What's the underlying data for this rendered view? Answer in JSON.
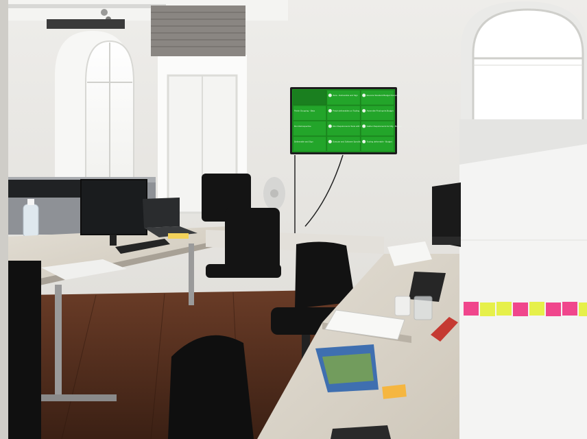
{
  "scene": {
    "description_label": "",
    "wall_color": "#e7e6e3",
    "floor_color": "#5a3322",
    "desk_color": "#dcd7cd"
  },
  "monitor_board": {
    "accent": "#1f9a25",
    "cells": [
      {
        "text": ""
      },
      {
        "text": "Zara - Deliverable and Sign"
      },
      {
        "text": "Execute Standard Budget Document"
      },
      {
        "text": "Finish Grouping - Beta"
      },
      {
        "text": "Fetch deliverables on Tooling"
      },
      {
        "text": "Assemble Final sprint Budget"
      },
      {
        "text": "Run Retrospective"
      },
      {
        "text": "Run Requirements Tests with Tooling"
      },
      {
        "text": "Gather Requirements for Mig - Budget"
      },
      {
        "text": "Deliverable and Sign"
      },
      {
        "text": "Execute and Software Specifications"
      },
      {
        "text": "Tooling deliverable - Budget"
      }
    ]
  },
  "sticky_notes": [
    {
      "color": "#f0468c"
    },
    {
      "color": "#e6f04a"
    },
    {
      "color": "#e6f04a"
    },
    {
      "color": "#f0468c"
    },
    {
      "color": "#e6f04a"
    },
    {
      "color": "#f0468c"
    },
    {
      "color": "#f0468c"
    },
    {
      "color": "#e6f04a"
    }
  ]
}
